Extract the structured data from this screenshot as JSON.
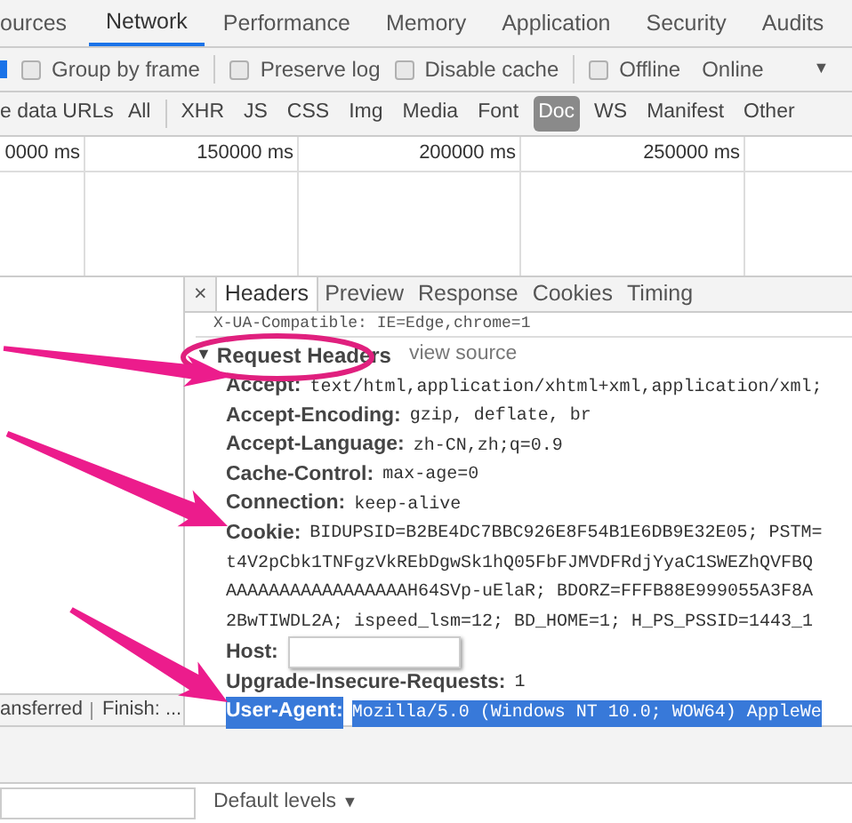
{
  "panel_tabs": [
    {
      "label": "ources",
      "selected": false
    },
    {
      "label": "Network",
      "selected": true
    },
    {
      "label": "Performance",
      "selected": false
    },
    {
      "label": "Memory",
      "selected": false
    },
    {
      "label": "Application",
      "selected": false
    },
    {
      "label": "Security",
      "selected": false
    },
    {
      "label": "Audits",
      "selected": false
    }
  ],
  "toolbar": {
    "options": [
      {
        "label": "Group by frame",
        "checked": false
      },
      {
        "label": "Preserve log",
        "checked": false
      },
      {
        "label": "Disable cache",
        "checked": false
      },
      {
        "label": "Offline",
        "checked": false
      }
    ],
    "throttling": "Online",
    "dropdown_arrow": "▼"
  },
  "filter_bar": {
    "hide_data_urls": "e data URLs",
    "types": [
      {
        "label": "All",
        "selected": false
      },
      {
        "label": "XHR",
        "selected": false
      },
      {
        "label": "JS",
        "selected": false
      },
      {
        "label": "CSS",
        "selected": false
      },
      {
        "label": "Img",
        "selected": false
      },
      {
        "label": "Media",
        "selected": false
      },
      {
        "label": "Font",
        "selected": false
      },
      {
        "label": "Doc",
        "selected": true
      },
      {
        "label": "WS",
        "selected": false
      },
      {
        "label": "Manifest",
        "selected": false
      },
      {
        "label": "Other",
        "selected": false
      }
    ]
  },
  "timeline": {
    "ticks": [
      "0000 ms",
      "150000 ms",
      "200000 ms",
      "250000 ms"
    ]
  },
  "detail": {
    "close": "×",
    "tabs": [
      {
        "label": "Headers",
        "selected": true
      },
      {
        "label": "Preview",
        "selected": false
      },
      {
        "label": "Response",
        "selected": false
      },
      {
        "label": "Cookies",
        "selected": false
      },
      {
        "label": "Timing",
        "selected": false
      }
    ],
    "previous_line": "X-UA-Compatible: IE=Edge,chrome=1",
    "section": {
      "toggle": "▼",
      "title": "Request Headers",
      "link": "view source"
    },
    "headers": [
      {
        "name": "Accept:",
        "kind": "text",
        "selected": false,
        "value_lines": [
          "text/html,application/xhtml+xml,application/xml;"
        ]
      },
      {
        "name": "Accept-Encoding:",
        "kind": "text",
        "selected": false,
        "value_lines": [
          "gzip, deflate, br"
        ]
      },
      {
        "name": "Accept-Language:",
        "kind": "text",
        "selected": false,
        "value_lines": [
          "zh-CN,zh;q=0.9"
        ]
      },
      {
        "name": "Cache-Control:",
        "kind": "text",
        "selected": false,
        "value_lines": [
          "max-age=0"
        ]
      },
      {
        "name": "Connection:",
        "kind": "text",
        "selected": false,
        "value_lines": [
          "keep-alive"
        ]
      },
      {
        "name": "Cookie:",
        "kind": "text",
        "selected": false,
        "value_lines": [
          "BIDUPSID=B2BE4DC7BBC926E8F54B1E6DB9E32E05; PSTM=",
          "t4V2pCbk1TNFgzVkREbDgwSk1hQ05FbFJMVDFRdjYyaC1SWEZhQVFBQ",
          "AAAAAAAAAAAAAAAAAH64SVp-uElaR; BDORZ=FFFB88E999055A3F8A",
          "2BwTIWDL2A; ispeed_lsm=12; BD_HOME=1; H_PS_PSSID=1443_1"
        ]
      },
      {
        "name": "Host:",
        "kind": "redacted",
        "selected": false
      },
      {
        "name": "Upgrade-Insecure-Requests:",
        "kind": "text",
        "selected": false,
        "value_lines": [
          "1"
        ]
      },
      {
        "name": "User-Agent:",
        "kind": "text",
        "selected": true,
        "value_lines": [
          "Mozilla/5.0 (Windows NT 10.0; WOW64) AppleWe"
        ]
      }
    ]
  },
  "status_bar": {
    "transferred": "ansferred",
    "finish": "Finish: ..."
  },
  "console": {
    "levels": "Default levels",
    "dropdown_arrow": "▼"
  }
}
